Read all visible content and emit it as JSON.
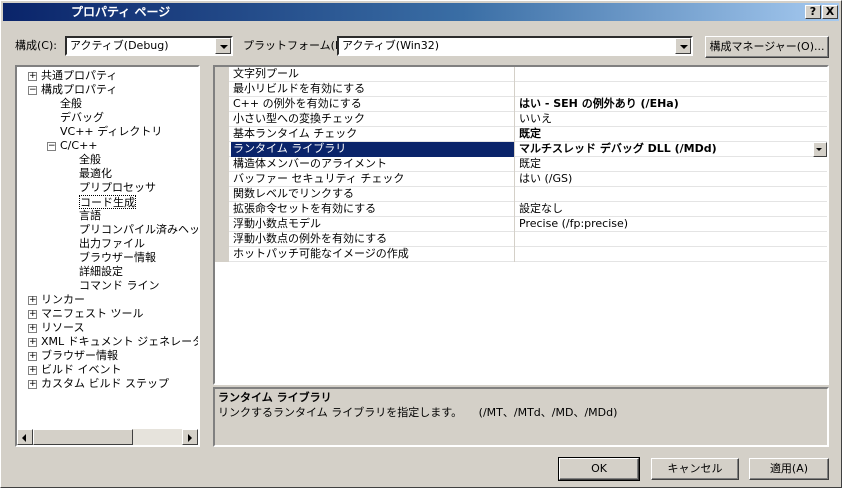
{
  "window": {
    "title": "プロパティ ページ",
    "help_label": "?",
    "close_label": "X"
  },
  "toolbar": {
    "config_label": "構成(C):",
    "config_value": "アクティブ(Debug)",
    "platform_label": "プラットフォーム(P):",
    "platform_value": "アクティブ(Win32)",
    "config_manager_label": "構成マネージャー(O)..."
  },
  "tree": {
    "items": [
      {
        "label": "共通プロパティ",
        "expander": "+"
      },
      {
        "label": "構成プロパティ",
        "expander": "−"
      },
      {
        "label": "全般"
      },
      {
        "label": "デバッグ"
      },
      {
        "label": "VC++ ディレクトリ"
      },
      {
        "label": "C/C++",
        "expander": "−"
      },
      {
        "label": "全般"
      },
      {
        "label": "最適化"
      },
      {
        "label": "プリプロセッサ"
      },
      {
        "label": "コード生成",
        "selected": true
      },
      {
        "label": "言語"
      },
      {
        "label": "プリコンパイル済みヘッダー"
      },
      {
        "label": "出力ファイル"
      },
      {
        "label": "ブラウザー情報"
      },
      {
        "label": "詳細設定"
      },
      {
        "label": "コマンド ライン"
      },
      {
        "label": "リンカー",
        "expander": "+"
      },
      {
        "label": "マニフェスト ツール",
        "expander": "+"
      },
      {
        "label": "リソース",
        "expander": "+"
      },
      {
        "label": "XML ドキュメント ジェネレーター",
        "expander": "+"
      },
      {
        "label": "ブラウザー情報",
        "expander": "+"
      },
      {
        "label": "ビルド イベント",
        "expander": "+"
      },
      {
        "label": "カスタム ビルド ステップ",
        "expander": "+"
      }
    ]
  },
  "grid": {
    "rows": [
      {
        "name": "文字列プール",
        "value": ""
      },
      {
        "name": "最小リビルドを有効にする",
        "value": ""
      },
      {
        "name": "C++ の例外を有効にする",
        "value": "はい - SEH の例外あり (/EHa)",
        "bold": true
      },
      {
        "name": "小さい型への変換チェック",
        "value": "いいえ"
      },
      {
        "name": "基本ランタイム チェック",
        "value": "既定",
        "bold": true
      },
      {
        "name": "ランタイム ライブラリ",
        "value": "マルチスレッド デバッグ DLL (/MDd)",
        "bold": true,
        "selected": true
      },
      {
        "name": "構造体メンバーのアライメント",
        "value": "既定"
      },
      {
        "name": "バッファー セキュリティ チェック",
        "value": "はい (/GS)"
      },
      {
        "name": "関数レベルでリンクする",
        "value": ""
      },
      {
        "name": "拡張命令セットを有効にする",
        "value": "設定なし"
      },
      {
        "name": "浮動小数点モデル",
        "value": "Precise (/fp:precise)"
      },
      {
        "name": "浮動小数点の例外を有効にする",
        "value": ""
      },
      {
        "name": "ホットパッチ可能なイメージの作成",
        "value": ""
      }
    ]
  },
  "description": {
    "title": "ランタイム ライブラリ",
    "text": "リンクするランタイム ライブラリを指定します。　　(/MT、/MTd、/MD、/MDd)"
  },
  "buttons": {
    "ok": "OK",
    "cancel": "キャンセル",
    "apply": "適用(A)"
  }
}
